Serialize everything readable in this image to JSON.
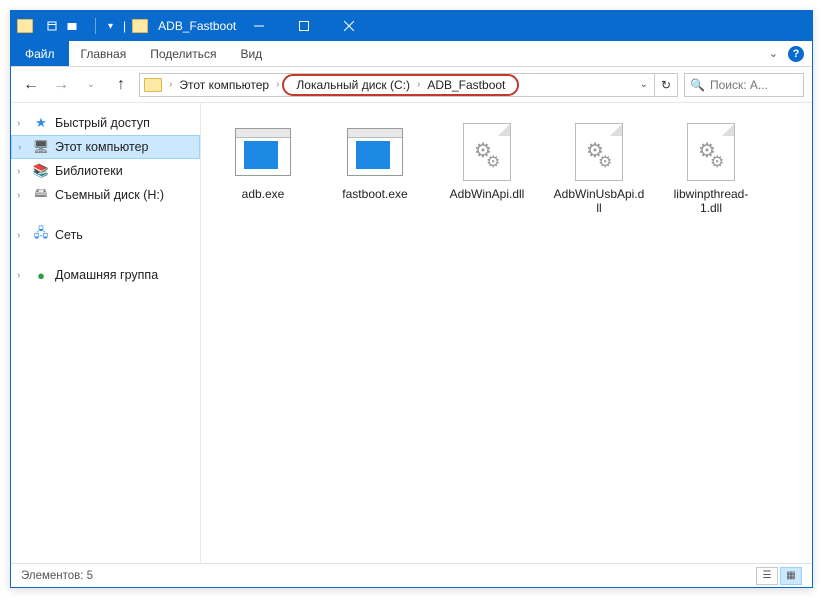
{
  "window": {
    "title": "ADB_Fastboot"
  },
  "ribbon": {
    "file": "Файл",
    "tabs": [
      "Главная",
      "Поделиться",
      "Вид"
    ]
  },
  "breadcrumb": {
    "root": "Этот компьютер",
    "drive": "Локальный диск (C:)",
    "folder": "ADB_Fastboot"
  },
  "search": {
    "placeholder": "Поиск: A..."
  },
  "sidebar": {
    "items": [
      {
        "label": "Быстрый доступ",
        "icon": "star"
      },
      {
        "label": "Этот компьютер",
        "icon": "pc",
        "selected": true
      },
      {
        "label": "Библиотеки",
        "icon": "lib"
      },
      {
        "label": "Съемный диск (H:)",
        "icon": "drive"
      },
      {
        "label": "Сеть",
        "icon": "net"
      },
      {
        "label": "Домашняя группа",
        "icon": "home"
      }
    ]
  },
  "files": [
    {
      "name": "adb.exe",
      "type": "exe"
    },
    {
      "name": "fastboot.exe",
      "type": "exe"
    },
    {
      "name": "AdbWinApi.dll",
      "type": "dll"
    },
    {
      "name": "AdbWinUsbApi.dll",
      "type": "dll"
    },
    {
      "name": "libwinpthread-1.dll",
      "type": "dll"
    }
  ],
  "status": {
    "count_label": "Элементов: 5"
  }
}
